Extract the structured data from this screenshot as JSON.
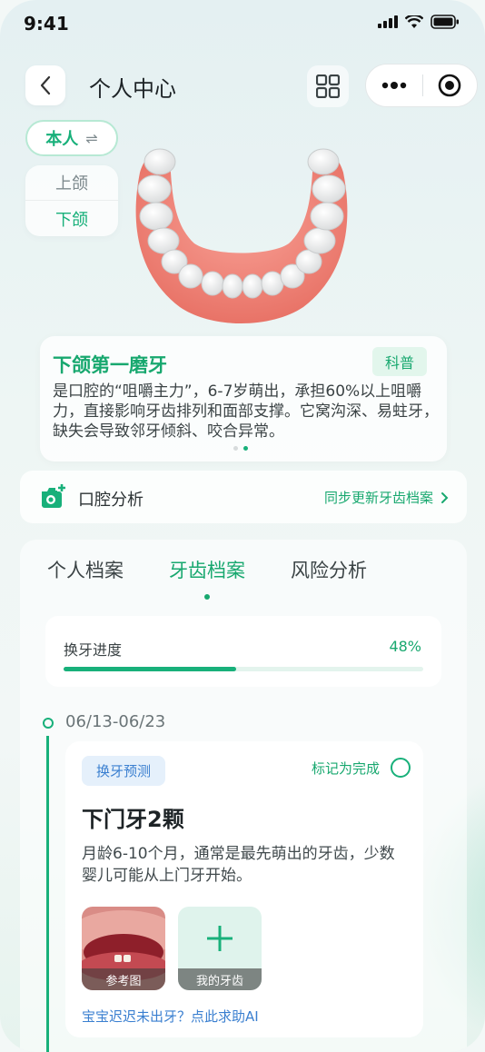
{
  "status": {
    "time": "9:41"
  },
  "header": {
    "title": "个人中心"
  },
  "person": {
    "label": "本人",
    "switch_icon": "⇌"
  },
  "jaw": {
    "upper": "上颌",
    "lower": "下颌"
  },
  "info": {
    "title": "下颌第一磨牙",
    "badge": "科普",
    "text": "是口腔的“咀嚼主力”，6-7岁萌出，承担60%以上咀嚼力，直接影响牙齿排列和面部支撑。它窝沟深、易蛀牙，缺失会导致邻牙倾斜、咬合异常。"
  },
  "analysis": {
    "label": "口腔分析",
    "link": "同步更新牙齿档案"
  },
  "tabs": [
    {
      "label": "个人档案"
    },
    {
      "label": "牙齿档案"
    },
    {
      "label": "风险分析"
    }
  ],
  "progress": {
    "label": "换牙进度",
    "value_text": "48%",
    "value": 0.48
  },
  "timeline": {
    "date": "06/13-06/23",
    "card": {
      "tag": "换牙预测",
      "complete_label": "标记为完成",
      "title": "下门牙2颗",
      "desc": "月龄6-10个月，通常是最先萌出的牙齿，少数婴儿可能从上门牙开始。",
      "ref_caption": "参考图",
      "mine_caption": "我的牙齿",
      "help": "宝宝迟迟未出牙？点此求助AI"
    }
  },
  "colors": {
    "accent": "#18b07a",
    "link": "#3a7fd0",
    "gum": "#f08a7e"
  }
}
